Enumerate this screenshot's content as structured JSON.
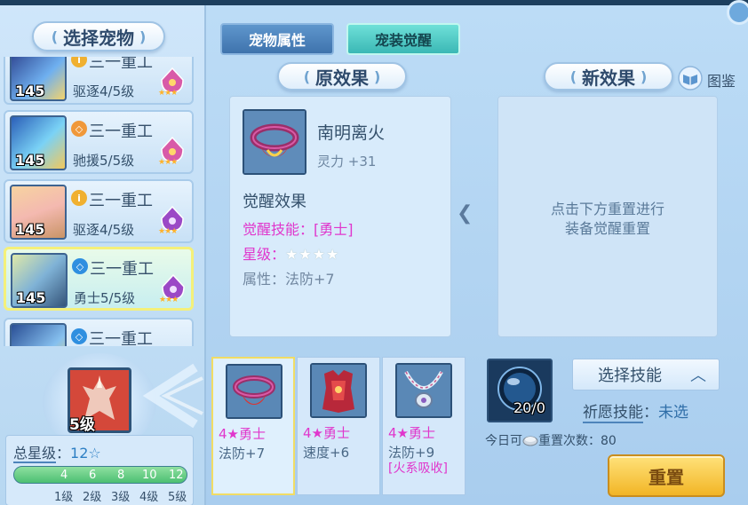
{
  "left": {
    "title": "选择宠物",
    "pets": [
      {
        "level": "145",
        "name": "三一重工",
        "class": "驱逐4/5级",
        "rank_color": "#f0b030",
        "rank_glyph": "i",
        "gem_color": "#d85aa8"
      },
      {
        "level": "145",
        "name": "三一重工",
        "class": "驰援5/5级",
        "rank_color": "#f0983a",
        "rank_glyph": "◇",
        "gem_color": "#d85aa8"
      },
      {
        "level": "145",
        "name": "三一重工",
        "class": "驱逐4/5级",
        "rank_color": "#f0b030",
        "rank_glyph": "i",
        "gem_color": "#9b49c6"
      },
      {
        "level": "145",
        "name": "三一重工",
        "class": "勇士5/5级",
        "rank_color": "#2f8fe0",
        "rank_glyph": "◇",
        "gem_color": "#9b49c6"
      },
      {
        "level": "",
        "name": "三一重工",
        "class": "",
        "rank_color": "#2f8fe0",
        "rank_glyph": "◇",
        "gem_color": "#9b49c6"
      }
    ],
    "equip_level": "5级",
    "total_star_label": "总星级",
    "total_star_value": "12☆",
    "progress_fraction": 1.0,
    "ticks": [
      "4",
      "6",
      "8",
      "10",
      "12"
    ],
    "levels": [
      "1级",
      "2级",
      "3级",
      "4级",
      "5级"
    ]
  },
  "tabs": {
    "attr": "宠物属性",
    "awaken": "宠装觉醒"
  },
  "original": {
    "title": "原效果",
    "item_name": "南明离火",
    "item_stat": "灵力 +31",
    "awaken_head": "觉醒效果",
    "skill_line": "觉醒技能：[勇士]",
    "star_label": "星级：",
    "stars": "★★★★",
    "attr_line": "属性：法防+7"
  },
  "new_effect": {
    "title": "新效果",
    "codex": "图鉴",
    "hint_line1": "点击下方重置进行",
    "hint_line2": "装备觉醒重置"
  },
  "options": [
    {
      "rank": "4★勇士",
      "stat": "法防+7",
      "extra": ""
    },
    {
      "rank": "4★勇士",
      "stat": "速度+6",
      "extra": ""
    },
    {
      "rank": "4★勇士",
      "stat": "法防+9",
      "extra": "[火系吸收]"
    }
  ],
  "skill": {
    "orb_count": "20/0",
    "select_label": "选择技能",
    "wish_label": "祈愿技能",
    "wish_sep": "：",
    "wish_value": "未选",
    "today_prefix": "今日可",
    "reset_count_label": "重置次数",
    "reset_count_value": "：80",
    "reset_button": "重置"
  }
}
